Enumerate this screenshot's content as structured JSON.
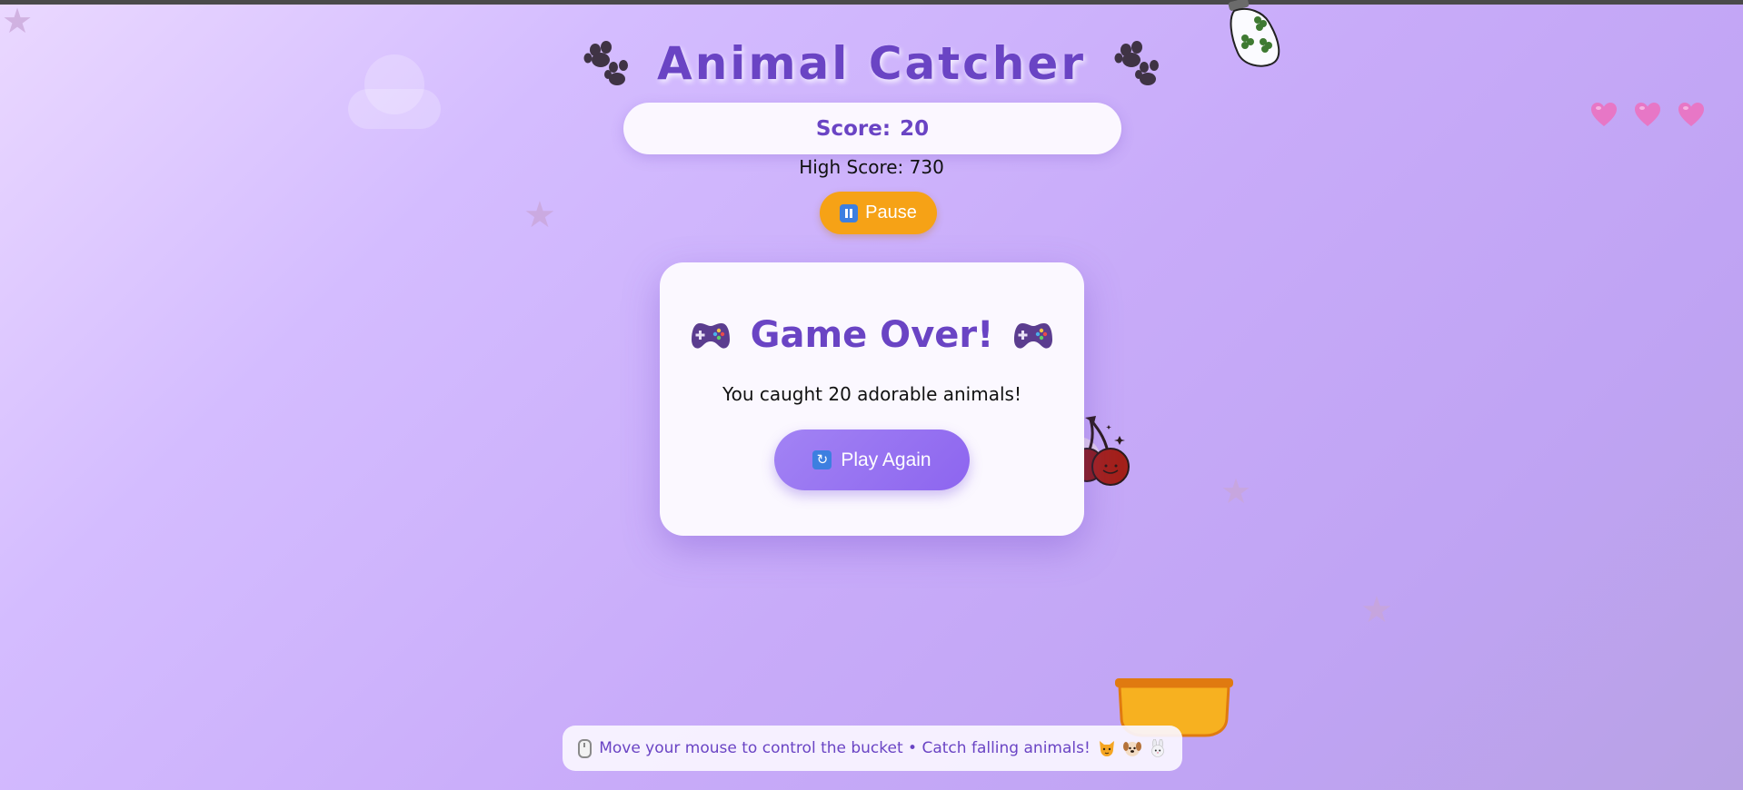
{
  "game": {
    "title": "Animal Catcher",
    "score_label": "Score:",
    "score_value": "20",
    "high_score": "High Score: 730",
    "pause_label": "Pause",
    "lives": 3
  },
  "game_over": {
    "title": "Game Over!",
    "message": "You caught 20 adorable animals!",
    "play_again_label": "Play Again"
  },
  "instructions": {
    "text": "Move your mouse to control the bucket • Catch falling animals!"
  },
  "icons": {
    "title_left": "paw-prints-icon",
    "title_right": "paw-prints-icon",
    "pause": "pause-icon",
    "game_over_left": "gamepad-icon",
    "game_over_right": "gamepad-icon",
    "play_again": "refresh-icon",
    "instructions": "mouse-icon",
    "animals": [
      "cat-icon",
      "dog-icon",
      "rabbit-icon"
    ],
    "life": "heart-icon"
  },
  "colors": {
    "accent": "#6a44c4",
    "pause_button": "#f6a216",
    "play_button": "#9370f2",
    "heart": "#e777c6",
    "bucket": "#f7b120"
  }
}
